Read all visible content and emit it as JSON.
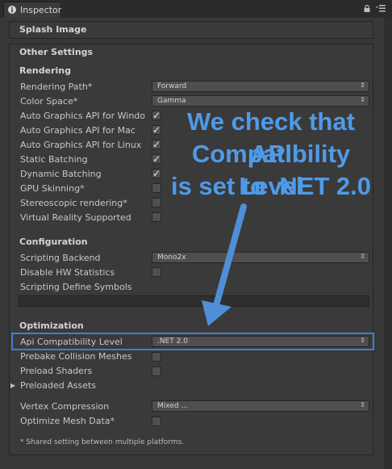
{
  "tab": {
    "title": "Inspector",
    "icon": "info-icon"
  },
  "header_icons": [
    "lock-icon",
    "menu-icon"
  ],
  "sections": {
    "splash": "Splash Image",
    "other": "Other Settings"
  },
  "rendering": {
    "title": "Rendering",
    "rendering_path": {
      "label": "Rendering Path*",
      "value": "Forward"
    },
    "color_space": {
      "label": "Color Space*",
      "value": "Gamma"
    },
    "auto_windows": {
      "label": "Auto Graphics API for Windo",
      "checked": true
    },
    "auto_mac": {
      "label": "Auto Graphics API for Mac",
      "checked": true
    },
    "auto_linux": {
      "label": "Auto Graphics API for Linux",
      "checked": true
    },
    "static_batching": {
      "label": "Static Batching",
      "checked": true
    },
    "dynamic_batching": {
      "label": "Dynamic Batching",
      "checked": true
    },
    "gpu_skinning": {
      "label": "GPU Skinning*",
      "checked": false
    },
    "stereoscopic": {
      "label": "Stereoscopic rendering*",
      "checked": false
    },
    "vr_supported": {
      "label": "Virtual Reality Supported",
      "checked": false
    }
  },
  "configuration": {
    "title": "Configuration",
    "scripting_backend": {
      "label": "Scripting Backend",
      "value": "Mono2x"
    },
    "disable_hw": {
      "label": "Disable HW Statistics",
      "checked": false
    },
    "define_symbols": {
      "label": "Scripting Define Symbols",
      "value": ""
    }
  },
  "optimization": {
    "title": "Optimization",
    "api_level": {
      "label": "Api Compatibility Level",
      "value": ".NET 2.0"
    },
    "prebake": {
      "label": "Prebake Collision Meshes",
      "checked": false
    },
    "preload_shaders": {
      "label": "Preload Shaders",
      "checked": false
    },
    "preloaded_assets": {
      "label": "Preloaded Assets"
    },
    "vertex_compression": {
      "label": "Vertex Compression",
      "value": "Mixed ..."
    },
    "optimize_mesh": {
      "label": "Optimize Mesh Data*",
      "checked": false
    }
  },
  "footnote": "* Shared setting between multiple platforms.",
  "annotation": {
    "line1": "We check that API",
    "line2": "Compatibility Level",
    "line3": "is set to .NET 2.0",
    "color": "#4f9ae8"
  },
  "checkmark": "✓",
  "dropdown_arrow": "⇕"
}
